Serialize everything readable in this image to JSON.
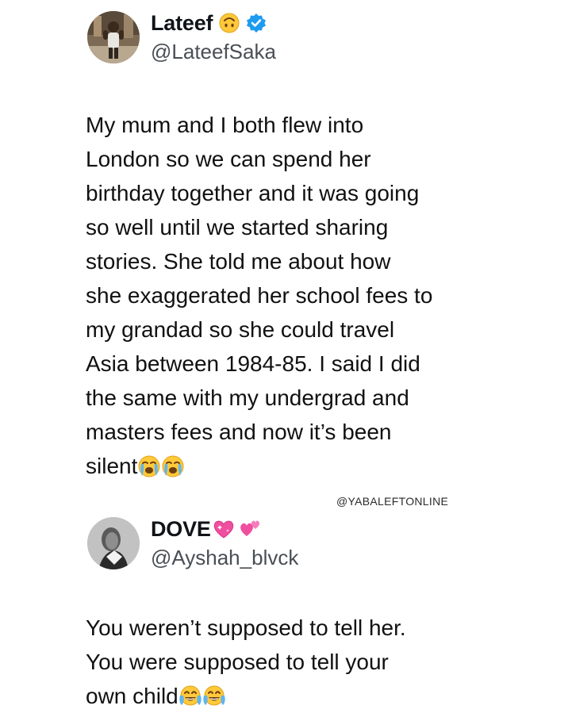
{
  "tweet1": {
    "display_name": "Lateef",
    "name_emoji": "upside-down-face-emoji",
    "verified": true,
    "verified_color": "#1d9bf0",
    "handle": "@LateefSaka",
    "lines": [
      "My mum and I both flew into",
      "London so we can spend her",
      "birthday together and it was going",
      "so well until we started sharing",
      "stories. She told me about how",
      "she exaggerated her school fees to",
      "my grandad so she could travel",
      "Asia between 1984-85. I said I did",
      "the same with my undergrad and",
      "masters fees and now it’s been",
      "silent"
    ],
    "trailing_emojis": [
      "loudly-crying-face-emoji",
      "loudly-crying-face-emoji"
    ]
  },
  "watermark": "@YABALEFTONLINE",
  "tweet2": {
    "display_name": "DOVE",
    "name_emojis": [
      "sparkling-heart-emoji",
      "two-hearts-emoji"
    ],
    "handle": "@Ayshah_blvck",
    "lines": [
      "You weren’t supposed to tell her.",
      "You were supposed to tell your",
      "own child"
    ],
    "trailing_emojis": [
      "face-with-tears-of-joy-emoji",
      "face-with-tears-of-joy-emoji"
    ]
  },
  "colors": {
    "text": "#111111",
    "handle": "#4a4f55",
    "verified": "#1d9bf0",
    "emoji_yellow": "#ffc93a",
    "heart_pink": "#f04fa0"
  }
}
